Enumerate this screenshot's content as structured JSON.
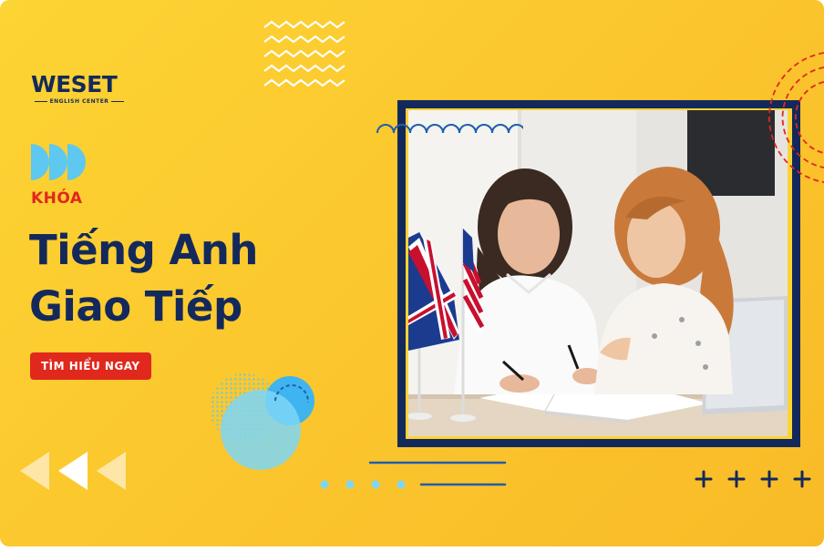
{
  "brand": {
    "name": "WESET",
    "tagline": "ENGLISH CENTER"
  },
  "headline": {
    "kicker": "KHÓA",
    "line1": "Tiếng Anh",
    "line2": "Giao Tiếp"
  },
  "cta": {
    "label": "TÌM HIỂU NGAY"
  },
  "colors": {
    "background": "#fbc52d",
    "navy": "#14295b",
    "red": "#e0281d",
    "light_blue": "#5ec8f0"
  },
  "icons": [
    "chevron-right-icon",
    "chevron-left-icon",
    "plus-icon",
    "zigzag-icon"
  ]
}
